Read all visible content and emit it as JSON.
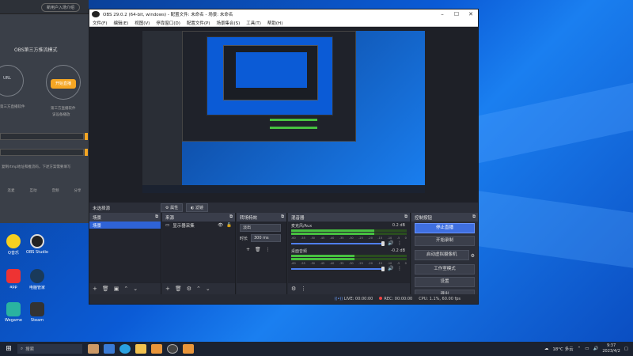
{
  "obs": {
    "title": "OBS 29.0.2 (64-bit, windows) - 配置文件: 未命名 - 场景: 未命名",
    "menu": [
      "文件(F)",
      "编辑(E)",
      "视图(V)",
      "停靠窗口(D)",
      "配置文件(P)",
      "场景集合(S)",
      "工具(T)",
      "帮助(H)"
    ],
    "scenebar": {
      "current": "未选择源",
      "properties": "属性",
      "filters": "滤镜"
    },
    "docks": {
      "scenes": {
        "title": "场景",
        "items": [
          "场景"
        ]
      },
      "sources": {
        "title": "来源",
        "items": [
          "显示器采集"
        ]
      },
      "transitions": {
        "title": "转场特效",
        "type": "淡出",
        "duration_label": "时长",
        "duration_value": "300 ms"
      },
      "mixer": {
        "title": "混音器",
        "channels": [
          {
            "name": "麦克风/Aux",
            "db": "0.2 dB",
            "level": 0.72
          },
          {
            "name": "桌面音频",
            "db": "-0.2 dB",
            "level": 0.55
          }
        ],
        "ticks": [
          "-60",
          "-55",
          "-50",
          "-45",
          "-40",
          "-35",
          "-30",
          "-25",
          "-20",
          "-15",
          "-10",
          "-5",
          "0"
        ]
      },
      "controls": {
        "title": "控制按钮",
        "buttons": [
          "停止直播",
          "开始录制",
          "启动虚拟摄像机",
          "工作室模式",
          "设置",
          "退出"
        ]
      }
    },
    "status": {
      "live": "LIVE: 00:00:00",
      "rec": "REC: 00:00:00",
      "cpu": "CPU: 1.1%, 60.00 fps"
    }
  },
  "leftapp": {
    "tab": "新用户入场介绍",
    "mode_title": "OBS第三方推流模式",
    "left_label": "URL",
    "left_sub": "第三方直播软件",
    "right_btn": "开始直播",
    "right_sub": "第三方直播软件",
    "right_sub2": "该设备播放",
    "hint": "复制rtmp地址和推流码，下述方案需要填写",
    "bottom": [
      "连麦",
      "互动",
      "音频",
      "分享"
    ]
  },
  "desktop_icons": [
    "Q音乐",
    "OBS Studio",
    "app",
    "电脑管家",
    "Wegame",
    "Steam"
  ],
  "taskbar": {
    "search": "搜索",
    "weather": "18°C 多云",
    "time": "9:37",
    "date": "2023/4/2"
  },
  "colors": {
    "accent": "#2f63d6",
    "stop_stream": "#3f6fe0",
    "meter": "#47c140",
    "orange": "#f5a623"
  }
}
